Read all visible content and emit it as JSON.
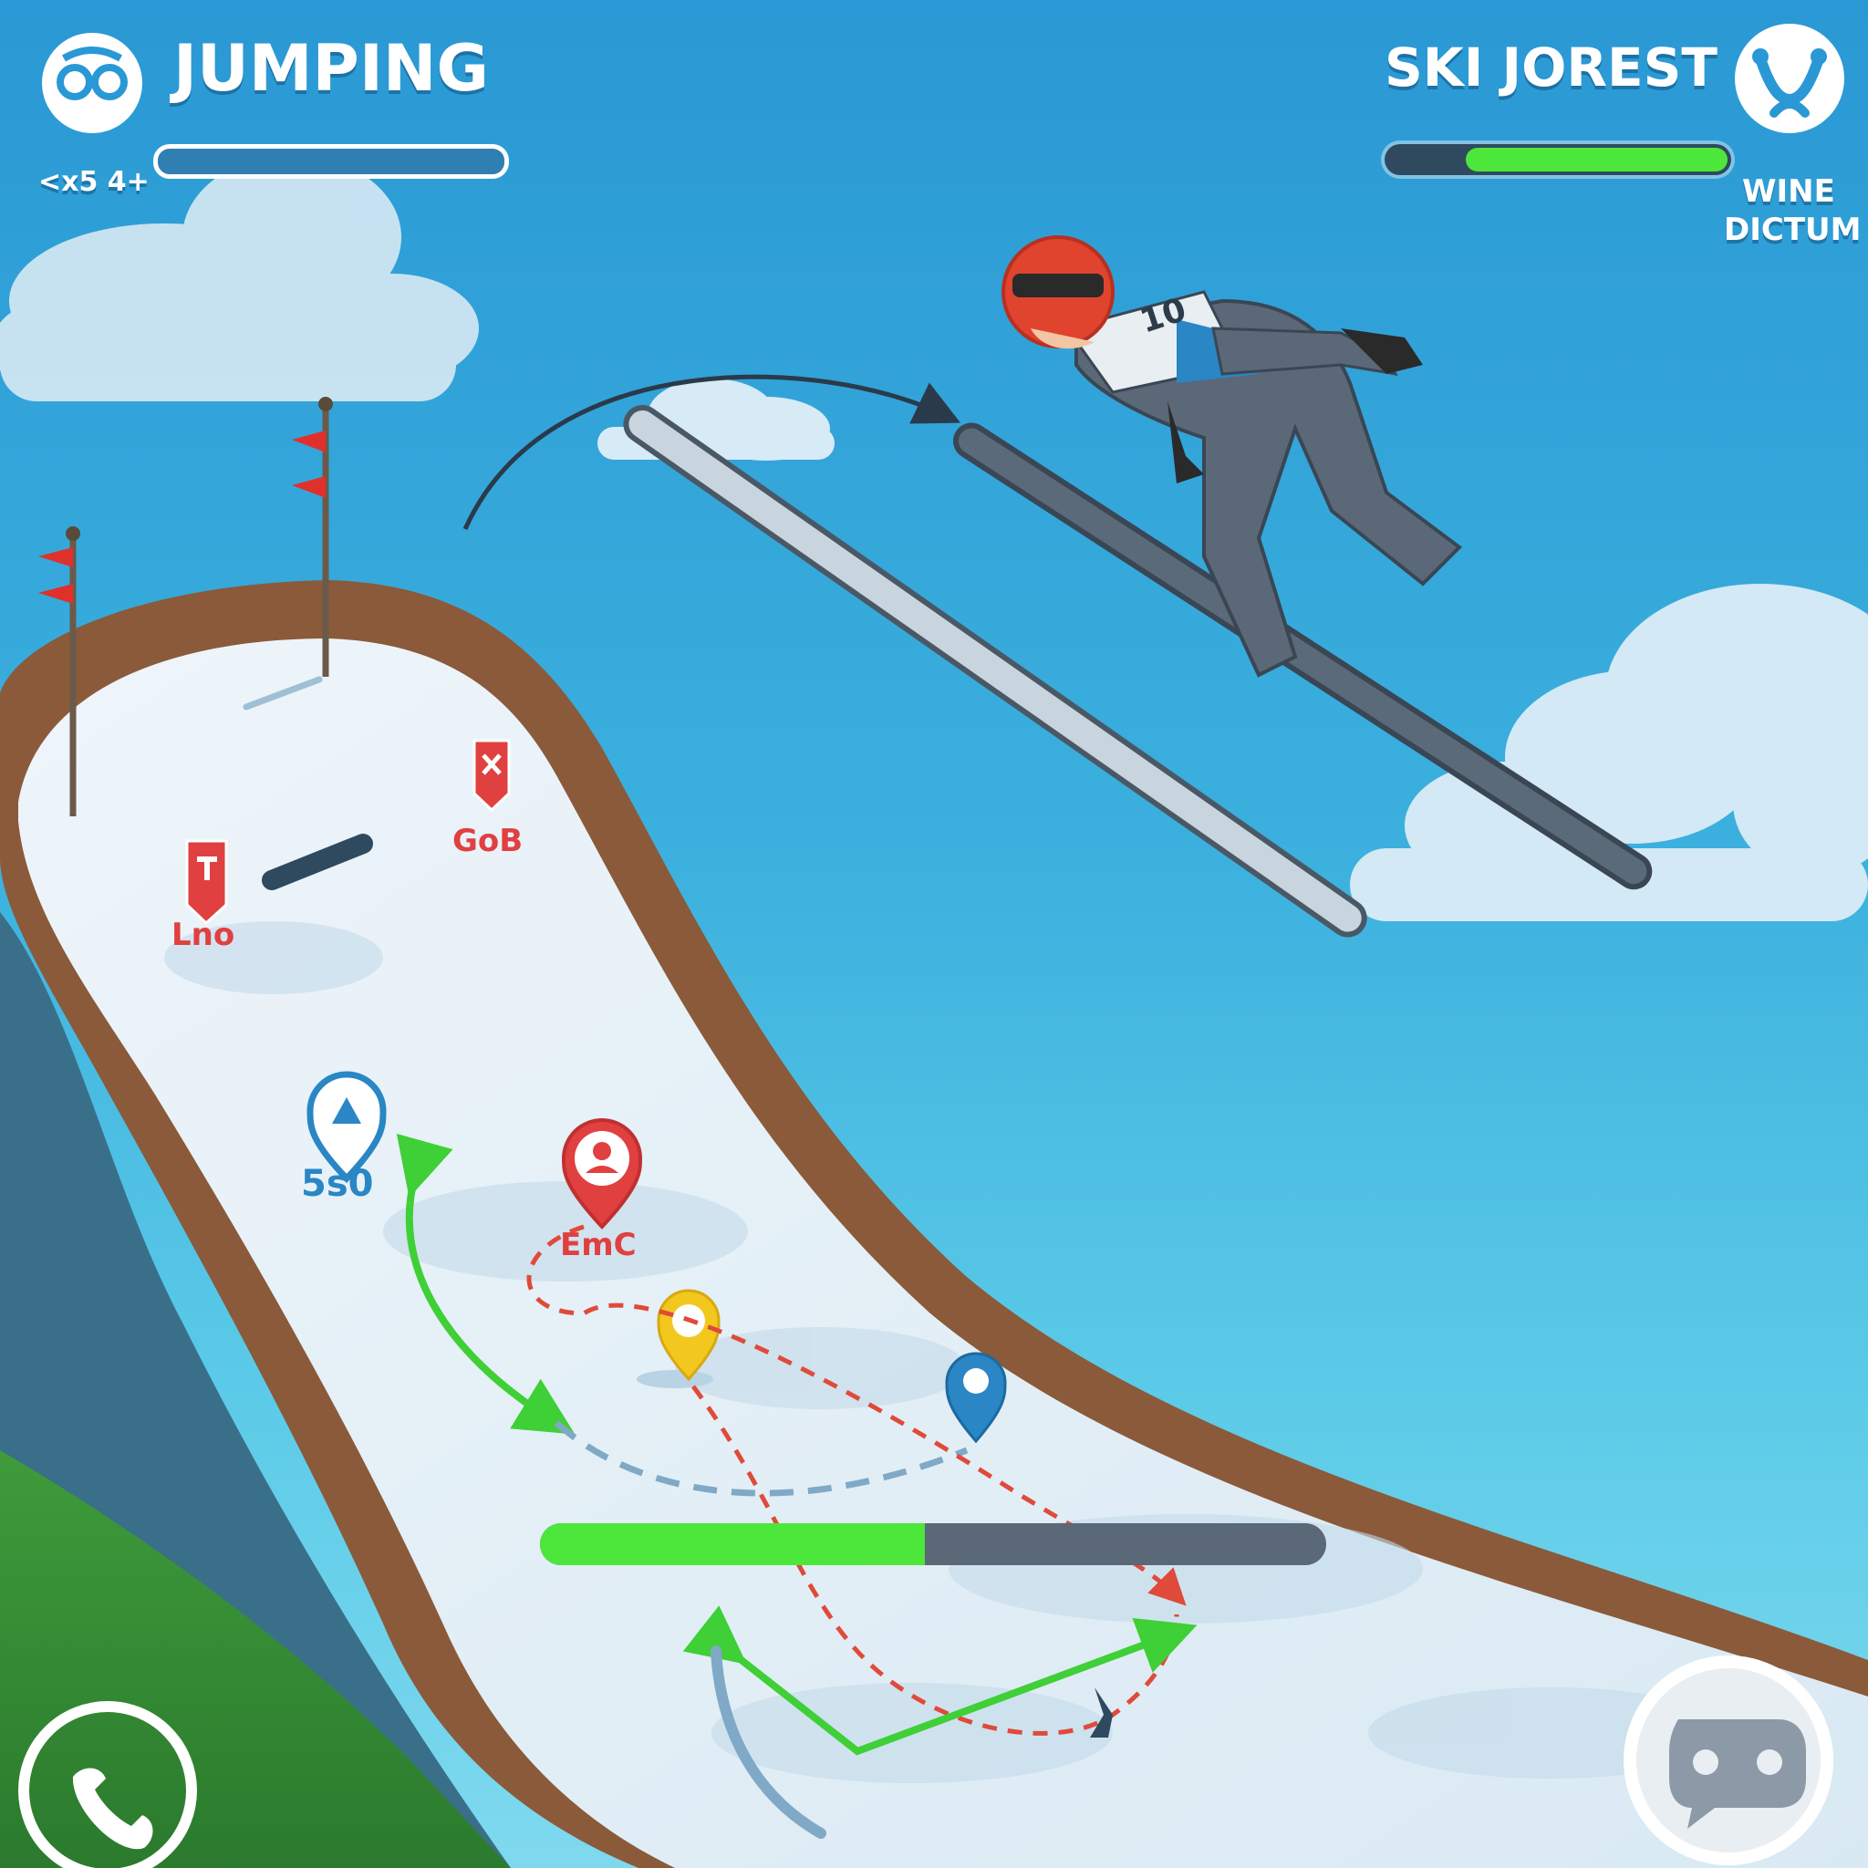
{
  "hud": {
    "left": {
      "title": "JUMPING",
      "sub_label": "<x5 4+",
      "progress": 0.0
    },
    "right": {
      "title": "SKI JOREST",
      "status_line1": "WINE",
      "status_line2": "DICTUM",
      "progress": 0.78
    }
  },
  "athlete": {
    "bib_number": "10"
  },
  "markers": {
    "red_x_label": "GoB",
    "red_flag_label": "Lno",
    "blue_marker_label": "5s0",
    "red_pin_label": "EmC"
  },
  "jump_meter": {
    "fill": 0.49
  },
  "colors": {
    "sky": "#2a98d4",
    "accent_green": "#4de63a",
    "marker_red": "#e04040",
    "marker_blue": "#2a86c4",
    "marker_yellow": "#f2c81e",
    "ramp_brown": "#8a5a3a"
  },
  "icons": {
    "left_avatar": "goggles-face-icon",
    "right_avatar": "helmet-icon",
    "bottom_left": "phone-icon",
    "bottom_right": "chat-icon"
  }
}
